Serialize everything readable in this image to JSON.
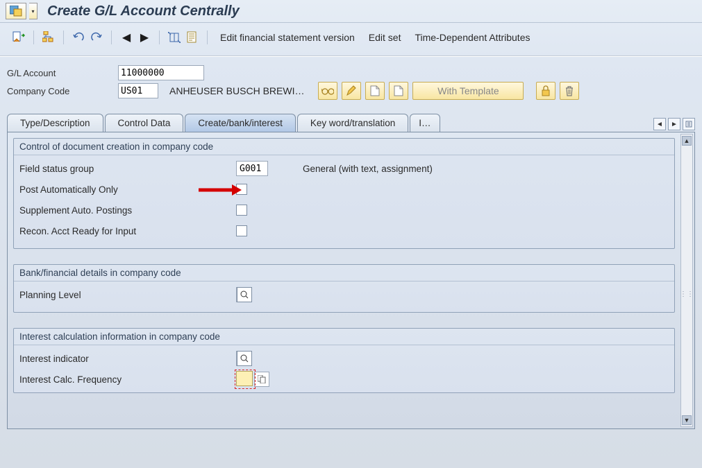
{
  "title": "Create G/L Account Centrally",
  "toolbar": {
    "edit_fsv": "Edit financial statement version",
    "edit_set": "Edit set",
    "time_dep": "Time-Dependent Attributes"
  },
  "header": {
    "gl_label": "G/L Account",
    "gl_value": "11000000",
    "cc_label": "Company Code",
    "cc_value": "US01",
    "cc_name": "ANHEUSER BUSCH BREWI…",
    "with_template": "With Template"
  },
  "tabs": {
    "t1": "Type/Description",
    "t2": "Control Data",
    "t3": "Create/bank/interest",
    "t4": "Key word/translation",
    "t5": "I…"
  },
  "g1": {
    "title": "Control of document creation in company code",
    "fsg_label": "Field status group",
    "fsg_value": "G001",
    "fsg_text": "General (with text, assignment)",
    "post_auto": "Post Automatically Only",
    "supp_auto": "Supplement Auto. Postings",
    "recon": "Recon. Acct Ready for Input"
  },
  "g2": {
    "title": "Bank/financial details in company code",
    "plan_label": "Planning Level",
    "plan_value": ""
  },
  "g3": {
    "title": "Interest calculation information in company code",
    "ind_label": "Interest indicator",
    "ind_value": "",
    "freq_label": "Interest Calc. Frequency",
    "freq_value": ""
  }
}
